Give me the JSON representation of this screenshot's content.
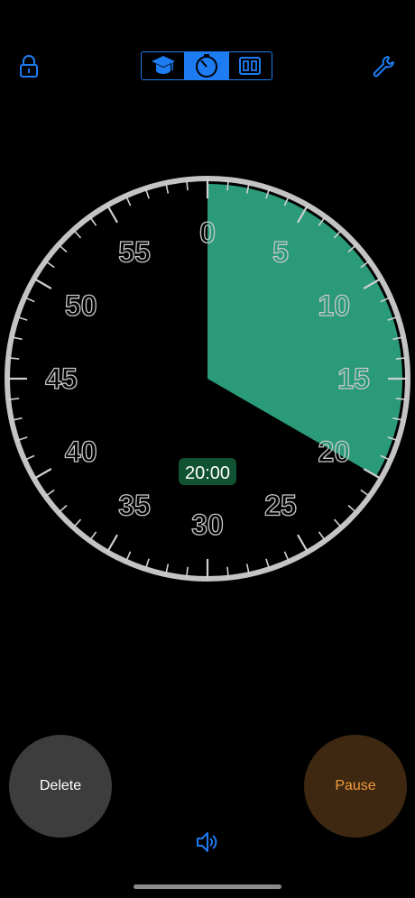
{
  "toolbar": {
    "lock_icon": "lock-icon",
    "wrench_icon": "wrench-icon",
    "modes": [
      {
        "name": "graduation-cap-icon",
        "active": false
      },
      {
        "name": "timer-icon",
        "active": true
      },
      {
        "name": "split-view-icon",
        "active": false
      }
    ],
    "accent_color": "#1e7cf2"
  },
  "timer": {
    "display": "20:00",
    "elapsed_fraction": 0.3333,
    "dial_numbers": [
      "0",
      "5",
      "10",
      "15",
      "20",
      "25",
      "30",
      "35",
      "40",
      "45",
      "50",
      "55"
    ],
    "wedge_color": "#2a9a78"
  },
  "controls": {
    "delete_label": "Delete",
    "pause_label": "Pause",
    "sound_icon": "speaker-icon"
  }
}
